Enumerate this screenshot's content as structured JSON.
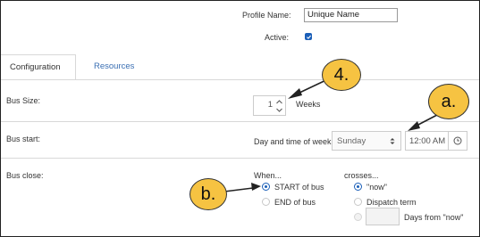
{
  "profile": {
    "name_label": "Profile Name:",
    "name_value": "Unique Name",
    "active_label": "Active:",
    "active_checked": true
  },
  "tabs": [
    {
      "label": "Configuration",
      "active": true
    },
    {
      "label": "Resources",
      "active": false
    }
  ],
  "bus_size": {
    "label": "Bus Size:",
    "value": "1",
    "unit": "Weeks"
  },
  "bus_start": {
    "label": "Bus start:",
    "prefix": "Day and time of week",
    "day": "Sunday",
    "time": "12:00 AM"
  },
  "bus_close": {
    "label": "Bus close:",
    "when_header": "When...",
    "when_options": [
      "START of bus",
      "END of bus"
    ],
    "when_selected": "START of bus",
    "crosses_header": "crosses...",
    "crosses_options": [
      "\"now\"",
      "Dispatch term",
      "Days from \"now\""
    ],
    "crosses_selected": "\"now\""
  },
  "callouts": [
    "4.",
    "a.",
    "b."
  ],
  "colors": {
    "accent": "#1b5fb8",
    "callout_fill": "#f6c342",
    "tab_inactive": "#3a6fb3"
  }
}
